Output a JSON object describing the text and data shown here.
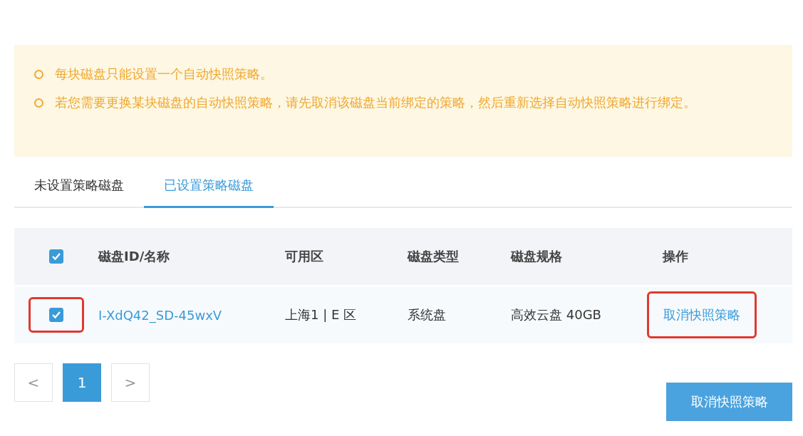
{
  "notice": {
    "items": [
      "每块磁盘只能设置一个自动快照策略。",
      "若您需要更换某块磁盘的自动快照策略，请先取消该磁盘当前绑定的策略，然后重新选择自动快照策略进行绑定。"
    ]
  },
  "tabs": [
    {
      "label": "未设置策略磁盘",
      "selected": false
    },
    {
      "label": "已设置策略磁盘",
      "selected": true
    }
  ],
  "table": {
    "header_checked": true,
    "columns": [
      "磁盘ID/名称",
      "可用区",
      "磁盘类型",
      "磁盘规格",
      "操作"
    ],
    "rows": [
      {
        "checked": true,
        "highlighted": true,
        "id": "I-XdQ42_SD-45wxV",
        "zone": "上海1 | E 区",
        "type": "系统盘",
        "spec": "高效云盘 40GB",
        "action": "取消快照策略",
        "action_highlighted": true
      }
    ]
  },
  "pagination": {
    "prev": "<",
    "pages": [
      {
        "label": "1",
        "selected": true
      }
    ],
    "next": ">"
  },
  "button": "取消快照策略"
}
